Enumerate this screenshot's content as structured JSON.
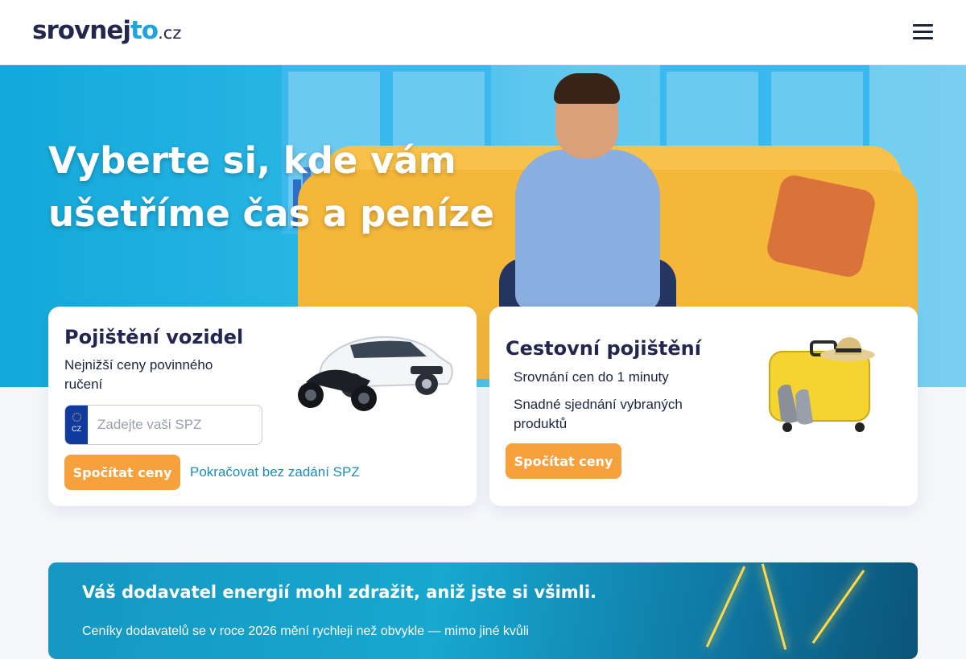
{
  "header": {
    "logo_main": "srovnej",
    "logo_accent": "to",
    "logo_tld": ".cz",
    "menu_icon": "hamburger-icon"
  },
  "hero": {
    "title_line1": "Vyberte si, kde vám",
    "title_line2": "ušetříme čas a peníze"
  },
  "vehicle_card": {
    "title": "Pojištění vozidel",
    "subtitle_line1": "Nejnižší ceny povinného",
    "subtitle_line2": "ručení",
    "spz_country": "CZ",
    "spz_placeholder": "Zadejte vaši SPZ",
    "spz_value": "",
    "button_label": "Spočítat ceny",
    "link_label": "Pokračovat bez zadání SPZ",
    "image_icon": "car-motorcycle-image"
  },
  "travel_card": {
    "title": "Cestovní pojištění",
    "bullets": [
      "Srovnání cen do 1 minuty",
      "Snadné sjednání vybraných",
      "produktů"
    ],
    "button_label": "Spočítat ceny",
    "image_icon": "suitcase-image"
  },
  "banner": {
    "title": "Váš dodavatel energií mohl zdražit, aniž jste si všimli.",
    "text": "Ceníky dodavatelů se v roce 2026 mění rychleji než obvykle — mimo jiné kvůli"
  },
  "colors": {
    "brand_dark": "#23264f",
    "brand_accent": "#1ea5e0",
    "button_orange": "#f7a13d",
    "link": "#1a8db5"
  }
}
